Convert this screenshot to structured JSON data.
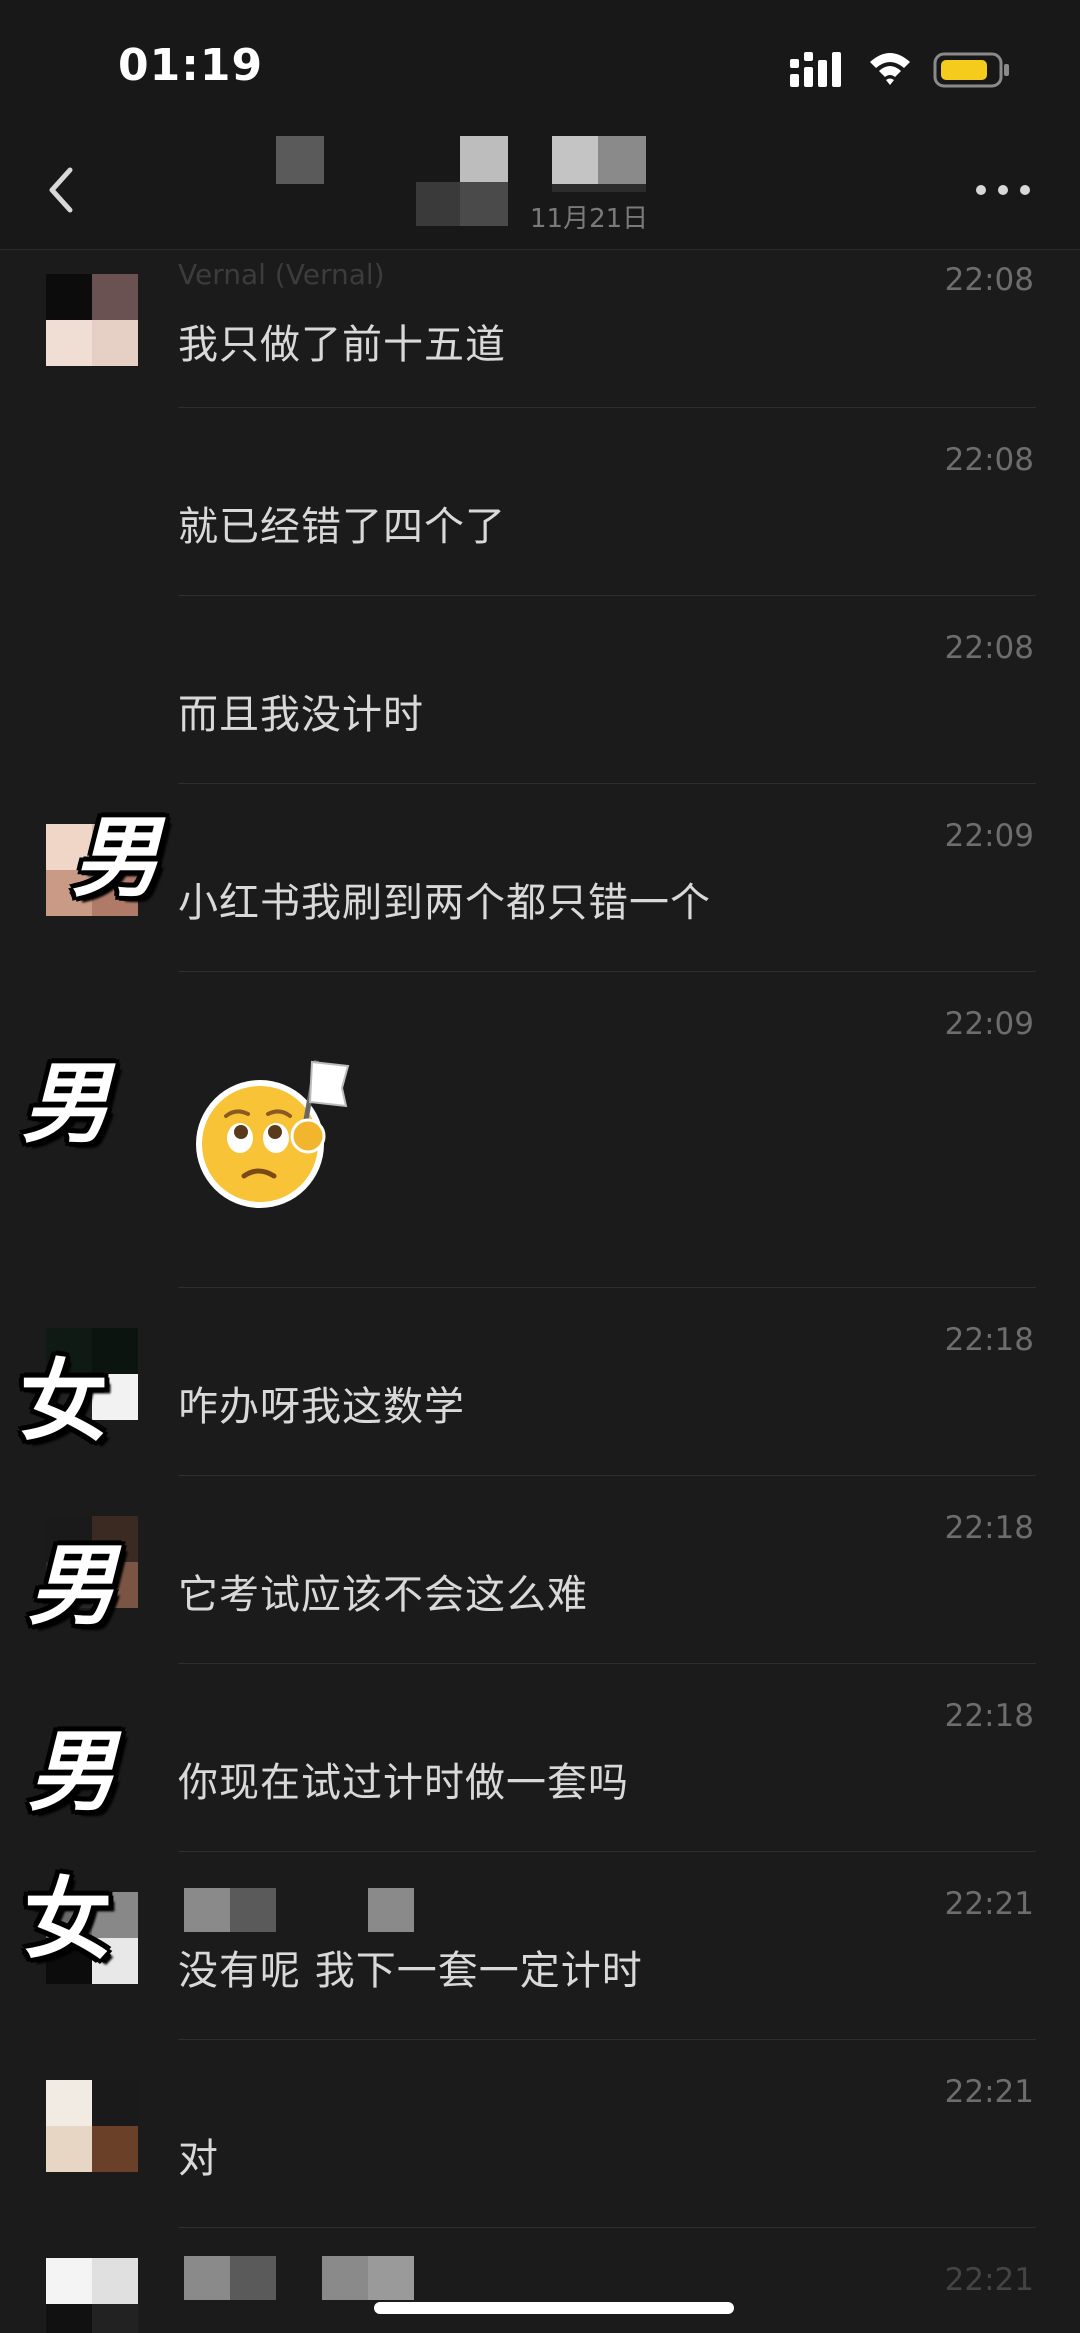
{
  "status_bar": {
    "time": "01:19",
    "signal_icon": "cellular-signal-icon",
    "wifi_icon": "wifi-icon",
    "battery_icon": "battery-icon",
    "battery_color": "#f5cc1c"
  },
  "nav": {
    "back_icon": "chevron-left-icon",
    "subtitle": "11月21日",
    "more_icon": "more-dots-icon"
  },
  "messages": [
    {
      "time": "22:08",
      "text": "我只做了前十五道",
      "sender": "Vernal (Vernal)"
    },
    {
      "time": "22:08",
      "text": "就已经错了四个了"
    },
    {
      "time": "22:08",
      "text": "而且我没计时"
    },
    {
      "time": "22:09",
      "text": "小红书我刷到两个都只错一个",
      "gender": "男"
    },
    {
      "time": "22:09",
      "sticker": "white-flag-sticker",
      "gender": "男"
    },
    {
      "time": "22:18",
      "text": "咋办呀我这数学",
      "gender": "女"
    },
    {
      "time": "22:18",
      "text": "它考试应该不会这么难",
      "gender": "男"
    },
    {
      "time": "22:18",
      "text": "你现在试过计时做一套吗",
      "gender": "男"
    },
    {
      "time": "22:21",
      "text": "没有呢 我下一套一定计时",
      "gender": "女"
    },
    {
      "time": "22:21",
      "text": "对"
    },
    {
      "time": "22:21"
    }
  ]
}
